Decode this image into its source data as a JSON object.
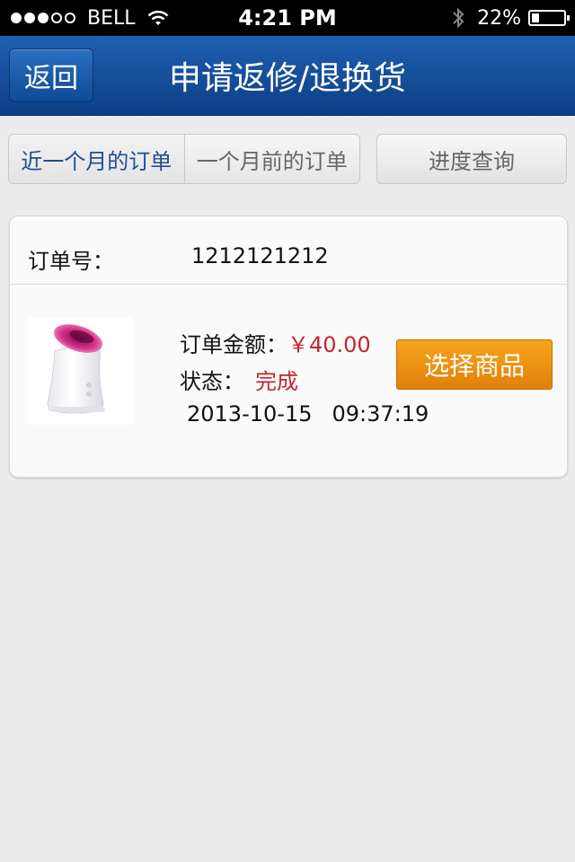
{
  "status_bar": {
    "carrier": "BELL",
    "time": "4:21 PM",
    "battery": "22%",
    "signal_bars_filled": 3,
    "signal_bars_total": 5
  },
  "nav": {
    "back_label": "返回",
    "title": "申请返修/退换货"
  },
  "tabs": {
    "recent": "近一个月的订单",
    "older": "一个月前的订单",
    "progress": "进度查询"
  },
  "order": {
    "number_label": "订单号：",
    "number": "1212121212",
    "amount_label": "订单金额：",
    "amount": "￥40.00",
    "status_label": "状态：",
    "status": "完成",
    "date": "2013-10-15",
    "time": "09:37:19",
    "select_button": "选择商品"
  },
  "colors": {
    "nav_bg": "#1b5aa8",
    "accent_orange": "#f29a14",
    "price_red": "#c1272d",
    "active_tab_text": "#1d4f93"
  },
  "icons": {
    "wifi": "wifi-icon",
    "bluetooth": "bluetooth-icon",
    "battery": "battery-icon",
    "product": "facial-steamer-image"
  }
}
